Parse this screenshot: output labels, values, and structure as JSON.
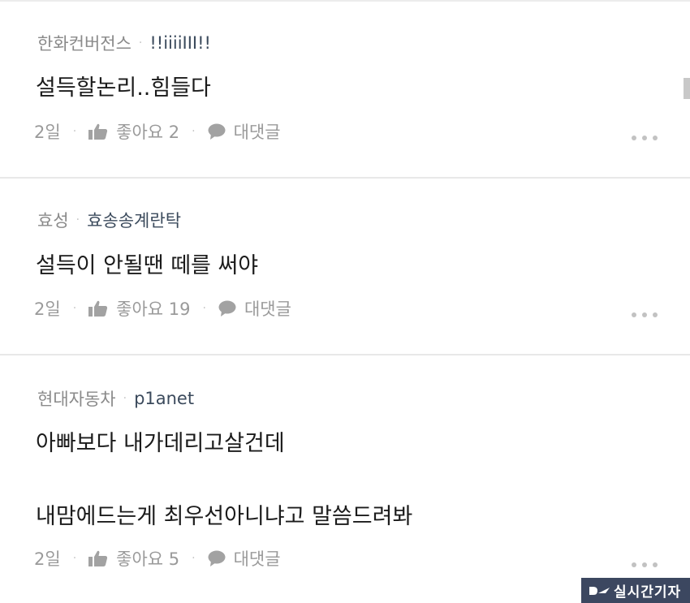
{
  "comments": [
    {
      "company": "한화컨버전스",
      "nickname": "!!iiiiIII!!",
      "body": [
        "설득할논리..힘들다"
      ],
      "time": "2일",
      "likes": "좋아요 2",
      "reply": "대댓글"
    },
    {
      "company": "효성",
      "nickname": "효송송계란탁",
      "body": [
        "설득이 안될땐 떼를 써야"
      ],
      "time": "2일",
      "likes": "좋아요 19",
      "reply": "대댓글"
    },
    {
      "company": "현대자동차",
      "nickname": "p1anet",
      "body": [
        "아빠보다 내가데리고살건데",
        "내맘에드는게 최우선아니냐고 말씀드려봐"
      ],
      "time": "2일",
      "likes": "좋아요 5",
      "reply": "대댓글"
    }
  ],
  "separator": "·",
  "icons": {
    "like": "thumbs-up-icon",
    "reply": "speech-bubble-icon",
    "more": "more-dots-icon"
  },
  "watermark": {
    "text": "실시간기자"
  },
  "colors": {
    "company": "#8a8a8a",
    "nickname": "#3b4a5c",
    "body": "#1b1b1b",
    "action": "#9a9a9a",
    "watermark_bg": "#3c4760"
  }
}
